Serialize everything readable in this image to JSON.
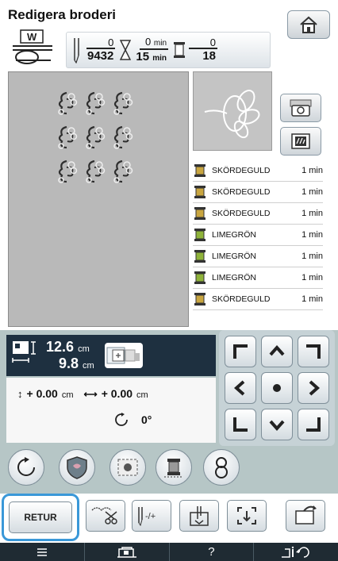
{
  "header": {
    "title": "Redigera broderi"
  },
  "presser_foot": {
    "label": "W"
  },
  "counters": {
    "stitch_top": "0",
    "stitch_bottom": "9432",
    "time_top": "0",
    "time_top_unit": "min",
    "time_bottom": "15",
    "time_bottom_unit": "min",
    "color_top": "0",
    "color_bottom": "18"
  },
  "thread_colors": [
    {
      "name": "SKÖRDEGULD",
      "time": "1 min",
      "color": "#c9a640"
    },
    {
      "name": "SKÖRDEGULD",
      "time": "1 min",
      "color": "#c9a640"
    },
    {
      "name": "SKÖRDEGULD",
      "time": "1 min",
      "color": "#c9a640"
    },
    {
      "name": "LIMEGRÖN",
      "time": "1 min",
      "color": "#8fb33a"
    },
    {
      "name": "LIMEGRÖN",
      "time": "1 min",
      "color": "#8fb33a"
    },
    {
      "name": "LIMEGRÖN",
      "time": "1 min",
      "color": "#8fb33a"
    },
    {
      "name": "SKÖRDEGULD",
      "time": "1 min",
      "color": "#c9a640"
    }
  ],
  "size": {
    "width": "12.6",
    "width_unit": "cm",
    "height": "9.8",
    "height_unit": "cm"
  },
  "position": {
    "v_value": "+ 0.00",
    "v_unit": "cm",
    "h_value": "+ 0.00",
    "h_unit": "cm",
    "angle": "0°"
  },
  "toolbar": {
    "retur_label": "RETUR"
  },
  "colors": {
    "accent": "#3a98d8",
    "bottom_bar": "#1f2b33",
    "control_area": "#b6c6c6"
  }
}
